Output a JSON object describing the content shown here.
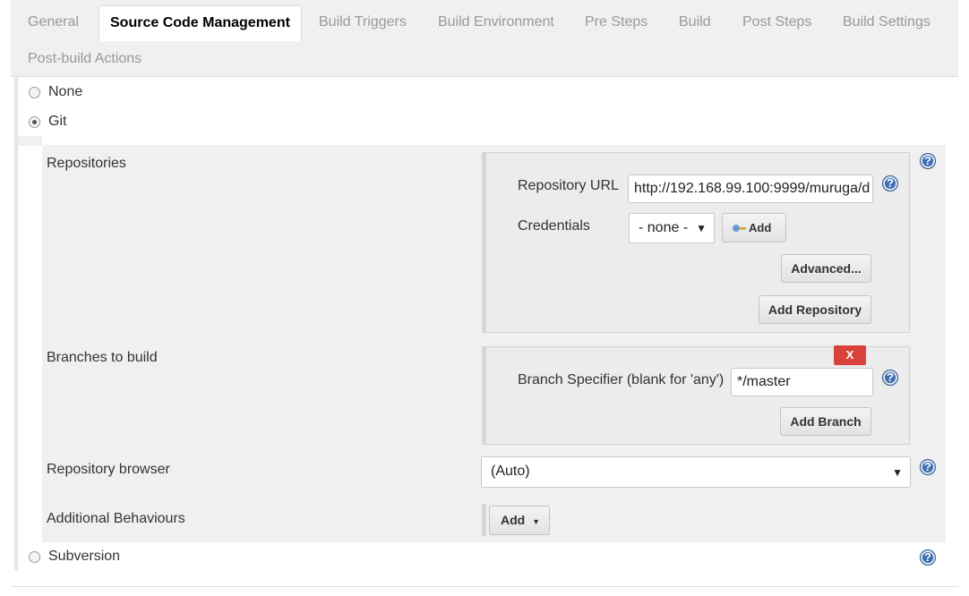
{
  "tabs": [
    {
      "label": "General"
    },
    {
      "label": "Source Code Management"
    },
    {
      "label": "Build Triggers"
    },
    {
      "label": "Build Environment"
    },
    {
      "label": "Pre Steps"
    },
    {
      "label": "Build"
    },
    {
      "label": "Post Steps"
    },
    {
      "label": "Build Settings"
    },
    {
      "label": "Post-build Actions"
    }
  ],
  "active_tab": "Source Code Management",
  "scm_options": {
    "none": "None",
    "git": "Git",
    "subversion": "Subversion",
    "selected": "Git"
  },
  "git": {
    "repositories_label": "Repositories",
    "repo_url_label": "Repository URL",
    "repo_url_value": "http://192.168.99.100:9999/muruga/d",
    "credentials_label": "Credentials",
    "credentials_value": "- none -",
    "credentials_add_label": "Add",
    "advanced_label": "Advanced...",
    "add_repository_label": "Add Repository",
    "branches_label": "Branches to build",
    "delete_branch_label": "X",
    "branch_specifier_label": "Branch Specifier (blank for 'any')",
    "branch_specifier_value": "*/master",
    "add_branch_label": "Add Branch",
    "repo_browser_label": "Repository browser",
    "repo_browser_value": "(Auto)",
    "additional_behaviours_label": "Additional Behaviours",
    "add_behaviour_label": "Add"
  },
  "help_label": "?",
  "colors": {
    "help_blue": "#3d6fb0",
    "delete_red": "#d9423a",
    "panel_gray": "#f0f0f0"
  }
}
